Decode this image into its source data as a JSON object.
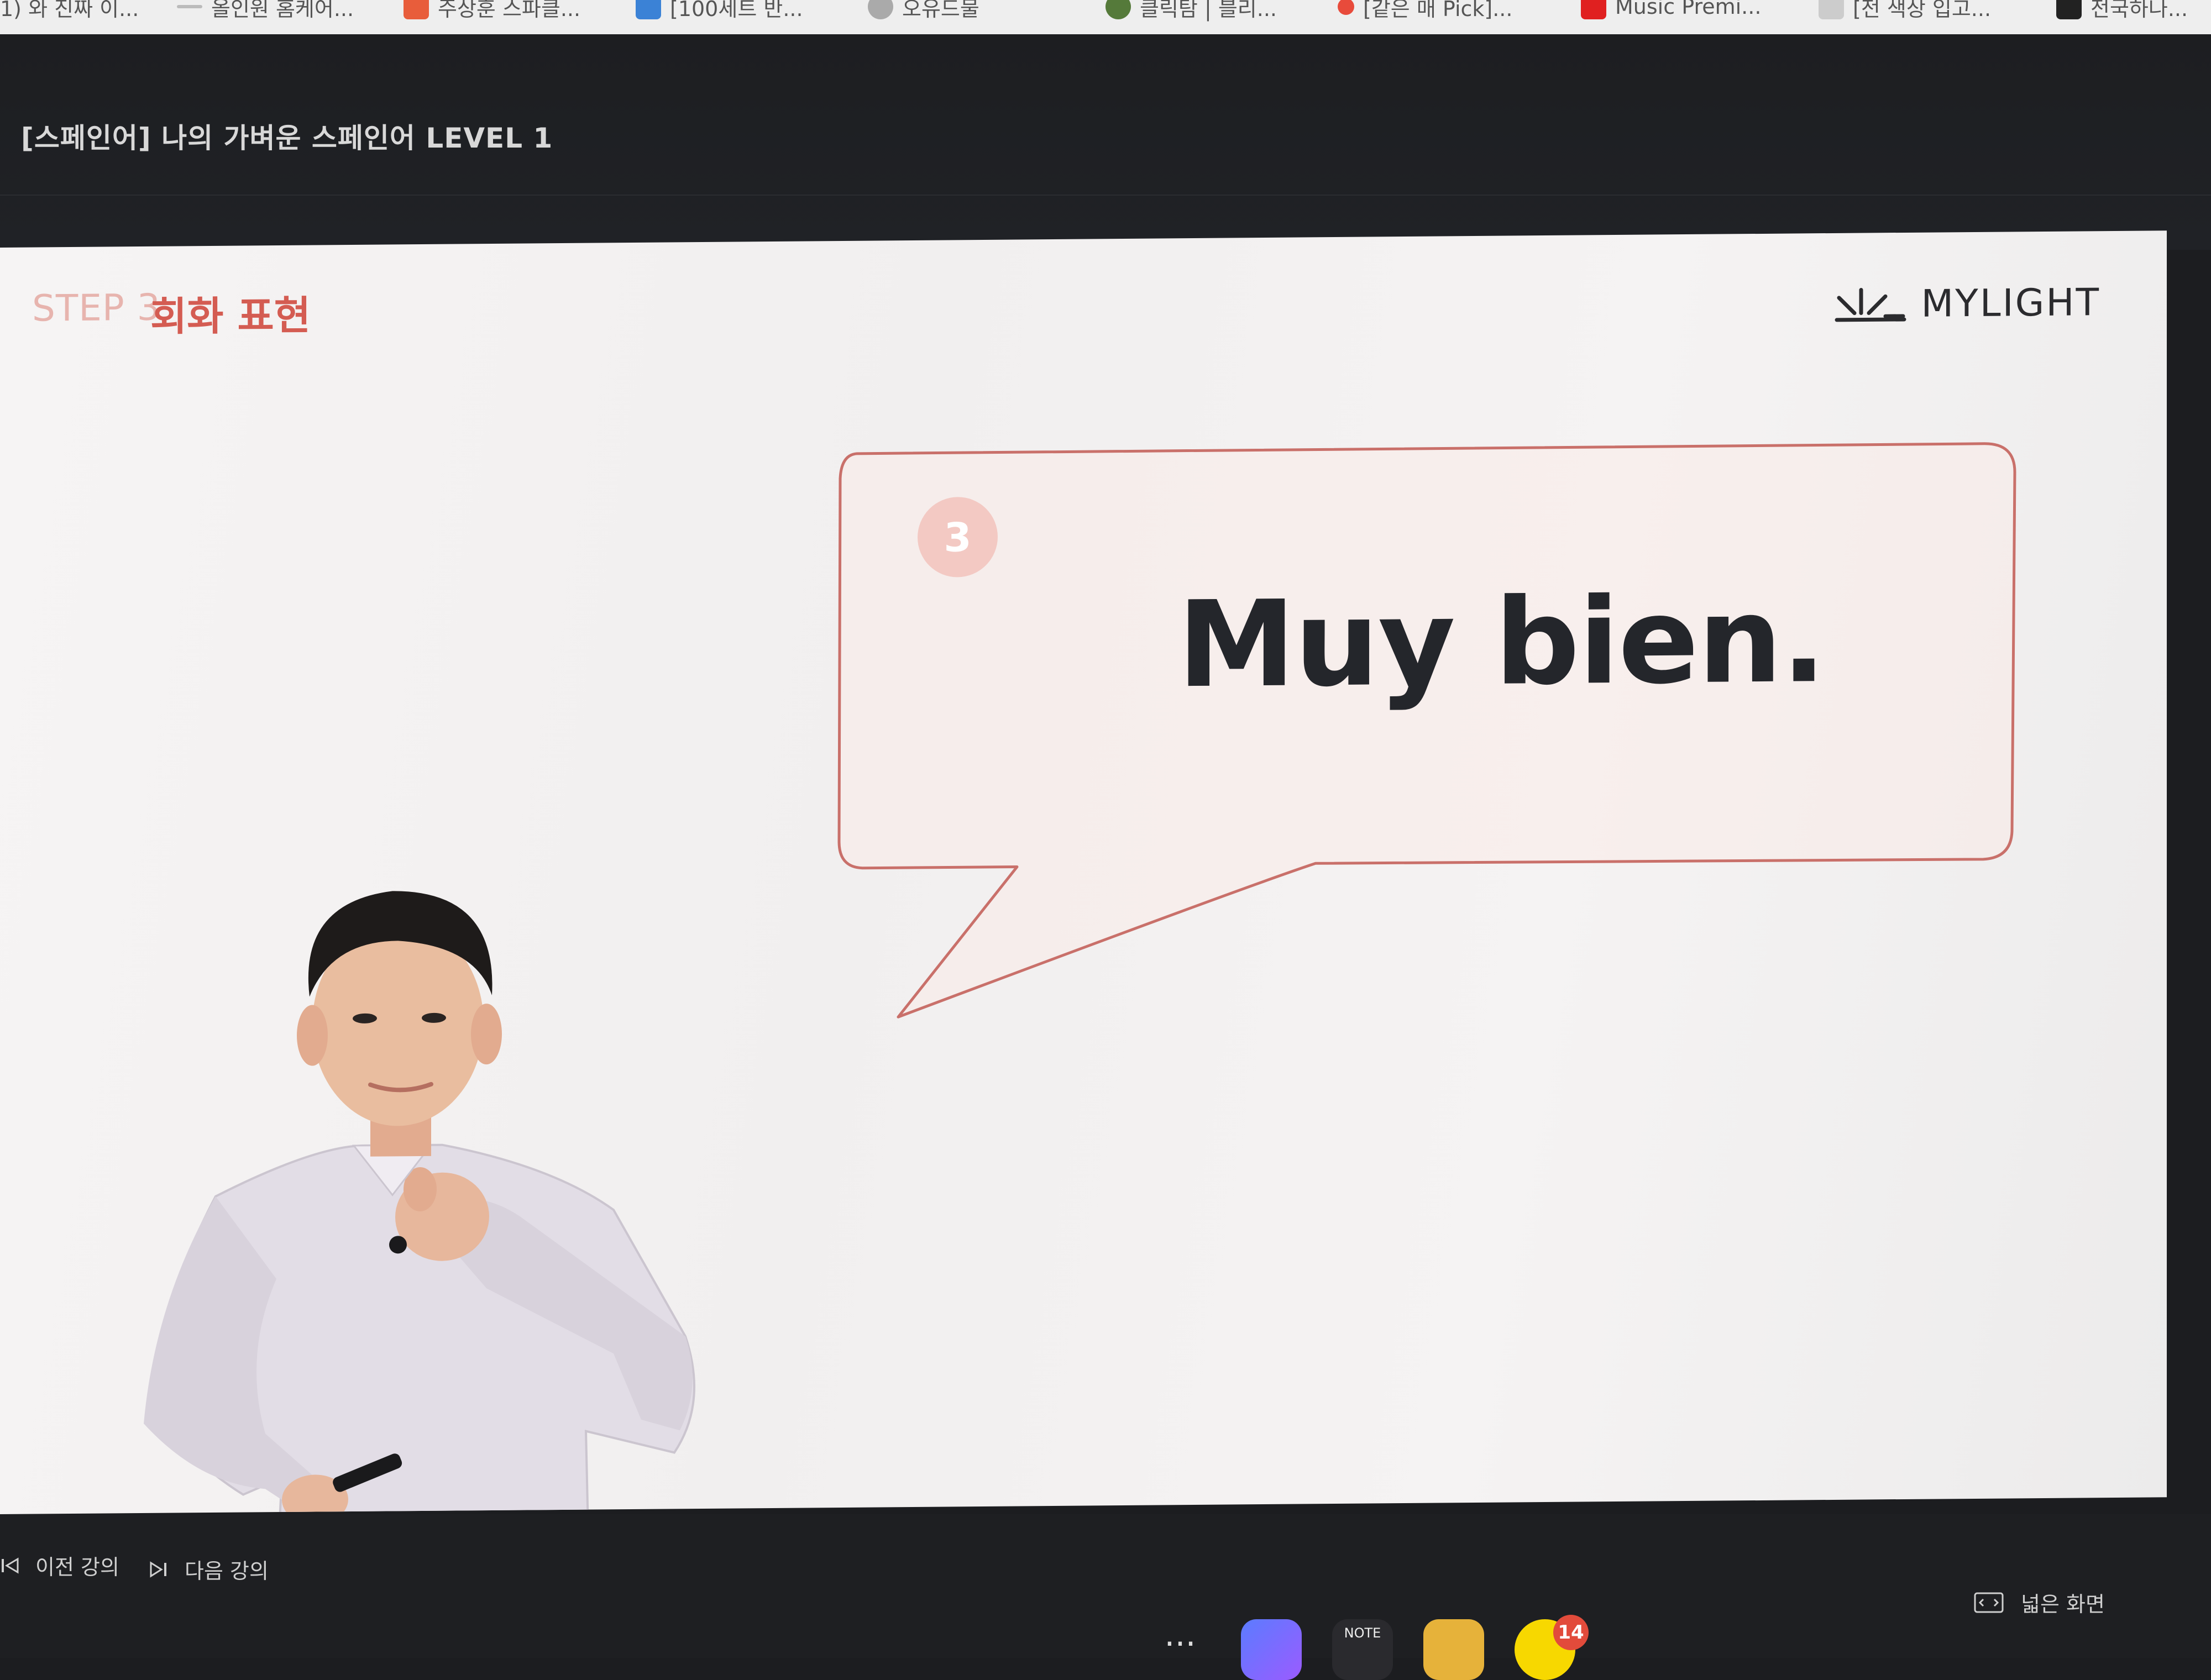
{
  "browser": {
    "bookmarks": [
      {
        "label": "1) 와 진짜 이...",
        "color": "#999999"
      },
      {
        "label": "올인원 홈케어...",
        "color": "#bbbbbb"
      },
      {
        "label": "주상훈 스파클...",
        "color": "#e85d3b"
      },
      {
        "label": "[100세트 반...",
        "color": "#3b82d6"
      },
      {
        "label": "오유드물",
        "color": "#aaaaaa"
      },
      {
        "label": "클릭탐 | 블리...",
        "color": "#557a3a"
      },
      {
        "label": "[같은 매 Pick]...",
        "color": "#e84b3b"
      },
      {
        "label": "Music Premi...",
        "color": "#e02020"
      },
      {
        "label": "[전 색상 입고...",
        "color": "#cccccc"
      },
      {
        "label": "전국하나...",
        "color": "#222222"
      }
    ]
  },
  "header": {
    "course_title": "[스페인어] 나의 가벼운 스페인어 LEVEL 1"
  },
  "lesson": {
    "step_label": "STEP 3",
    "step_title": "회화 표현",
    "brand": "MYLIGHT",
    "badge_number": "3",
    "phrase": "Muy bien."
  },
  "controls": {
    "prev_label": "이전 강의",
    "next_label": "다음 강의",
    "wide_label": "넓은 화면"
  },
  "dock": {
    "items": [
      {
        "name": "more-icon",
        "text": "···"
      },
      {
        "name": "app-icon-blue"
      },
      {
        "name": "note-app-icon",
        "text": "NOTE"
      },
      {
        "name": "app-icon-yellow"
      },
      {
        "name": "chat-app-icon",
        "badge": "14"
      }
    ]
  },
  "colors": {
    "accent": "#d45c52",
    "bubble_stroke": "#c9706a",
    "badge": "#f3c9c3"
  }
}
